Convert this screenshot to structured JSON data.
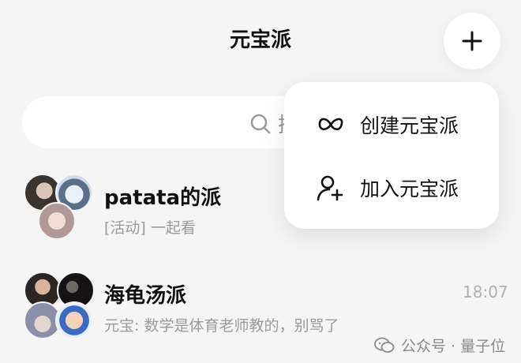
{
  "header": {
    "title": "元宝派"
  },
  "search": {
    "placeholder": "搜索"
  },
  "menu": {
    "create_label": "创建元宝派",
    "join_label": "加入元宝派"
  },
  "chats": [
    {
      "name": "patata的派",
      "message": "[活动] 一起看",
      "time": ""
    },
    {
      "name": "海龟汤派",
      "message": "元宝: 数学是体育老师教的，别骂了",
      "time": "18:07"
    }
  ],
  "watermark": {
    "text": "公众号 · 量子位"
  },
  "icons": {
    "add": "plus-icon",
    "search": "search-icon",
    "create": "infinity-icon",
    "join": "add-user-icon",
    "watermark": "wechat-icon"
  },
  "colors": {
    "background": "#f5f5f5",
    "card": "#ffffff",
    "text_primary": "#111111",
    "text_secondary": "#9a9a9a"
  }
}
